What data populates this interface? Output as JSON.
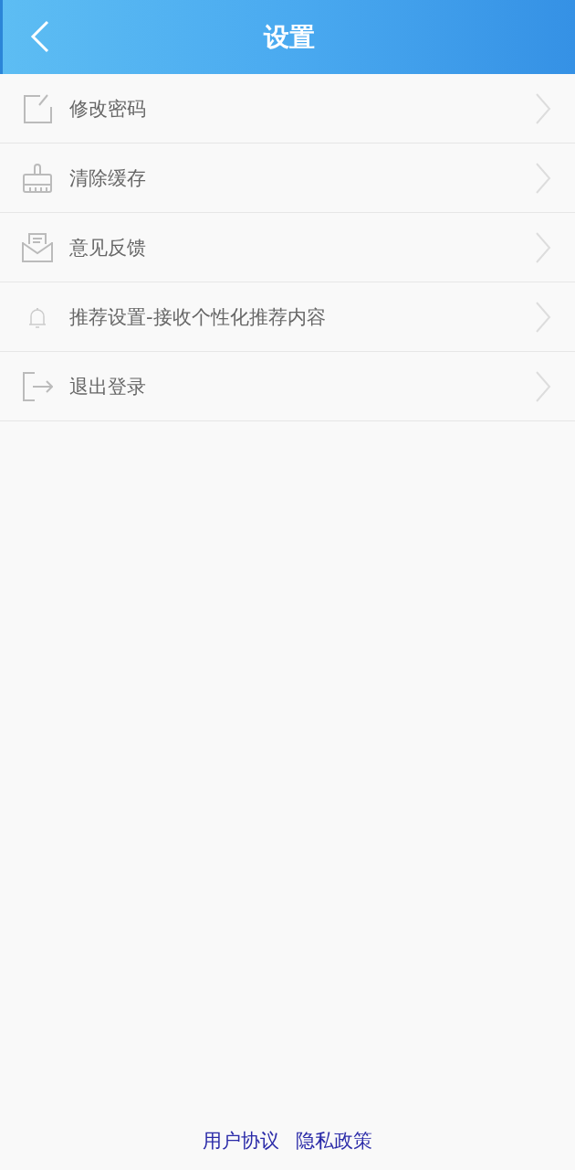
{
  "header": {
    "title": "设置"
  },
  "items": [
    {
      "label": "修改密码",
      "kind": "edit"
    },
    {
      "label": "清除缓存",
      "kind": "brush"
    },
    {
      "label": "意见反馈",
      "kind": "mail"
    },
    {
      "label": "推荐设置-接收个性化推荐内容",
      "kind": "bell"
    },
    {
      "label": "退出登录",
      "kind": "logout"
    }
  ],
  "footer_links": [
    "用户协议",
    "隐私政策"
  ]
}
